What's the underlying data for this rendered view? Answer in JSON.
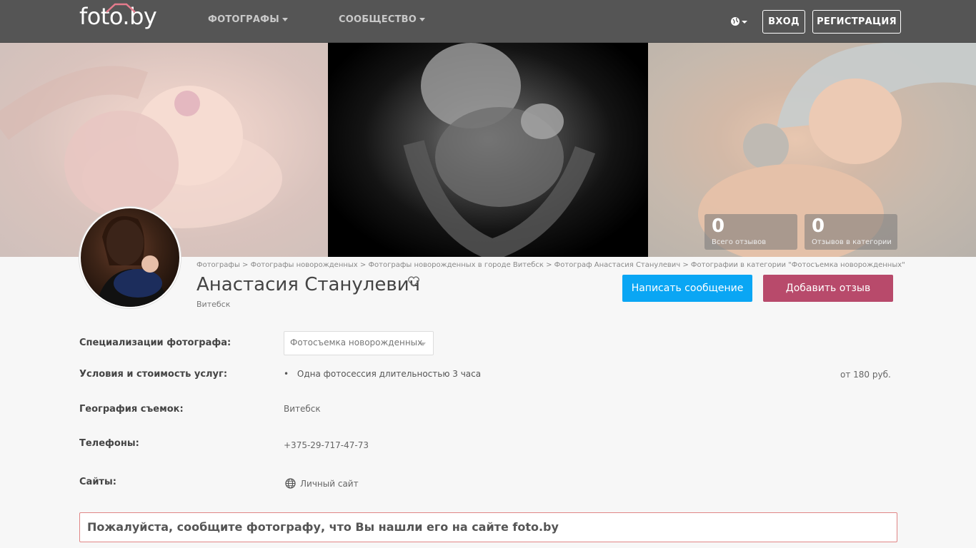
{
  "header": {
    "logo": "foto.by",
    "nav": [
      {
        "label": "ФОТОГРАФЫ"
      },
      {
        "label": "СООБЩЕСТВО"
      }
    ],
    "login_label": "ВХОД",
    "register_label": "РЕГИСТРАЦИЯ"
  },
  "cover": {
    "stats": [
      {
        "value": "0",
        "label": "Всего отзывов"
      },
      {
        "value": "0",
        "label": "Отзывов в категории"
      }
    ]
  },
  "profile": {
    "breadcrumb": "Фотографы > Фотографы новорожденных > Фотографы новорожденных в городе Витебск > Фотограф Анастасия Станулевич > Фотографии в категории \"Фотосъемка новорожденных\"",
    "name": "Анастасия Станулевич",
    "city": "Витебск",
    "message_button": "Написать сообщение",
    "review_button": "Добавить отзыв"
  },
  "info": {
    "specializations_label": "Специализации фотографа:",
    "specialization_selected": "Фотосъемка новорожденных",
    "services_label": "Условия и стоимость услуг:",
    "service_item": "Одна фотосессия длительностью 3 часа",
    "service_price": "от 180 руб.",
    "geography_label": "География съемок:",
    "geography_value": "Витебск",
    "phones_label": "Телефоны:",
    "phone_value": "+375-29-717-47-73",
    "sites_label": "Сайты:",
    "site_link": "Личный сайт"
  },
  "notice": "Пожалуйста, сообщите фотографу, что Вы нашли его на сайте foto.by",
  "colors": {
    "header_bg": "#555555",
    "message_btn": "#0aa6f4",
    "review_btn": "#b84a6b",
    "notice_border": "#e08585"
  }
}
